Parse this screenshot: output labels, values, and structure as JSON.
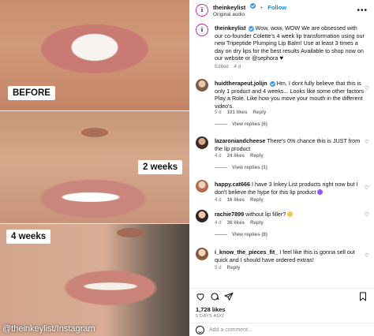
{
  "photos": {
    "labels": {
      "before": "BEFORE",
      "two_weeks": "2 weeks",
      "four_weeks": "4 weeks"
    },
    "credit": "@theinkeylist/Instagram"
  },
  "post": {
    "username": "theinkeylist",
    "follow_label": "Follow",
    "audio": "Original audio",
    "caption": {
      "user": "theinkeylist",
      "text": "Wow, wow, WOW We are obsessed with our co-founder Colette's 4 week lip transformation using our new Tripeptide Plumping Lip Balm! Use at least 3 times a day on dry lips for the best results Available to shop now on our website or @sephora",
      "edited": "Edited",
      "time": "4 d"
    },
    "comments": [
      {
        "user": "huidtherapeut.jolijn",
        "text": "Hm, I dont fully believe that this is only 1 product and 4 weeks... Looks like some other factors Play a Role. Like how you move your mouth in the different video's.",
        "time": "5 d",
        "likes": "101 likes",
        "reply": "Reply",
        "view_replies": "View replies (6)"
      },
      {
        "user": "lazaroniandcheese",
        "text": "There's 0% chance this is JUST from the lip product",
        "time": "4 d",
        "likes": "24 likes",
        "reply": "Reply",
        "view_replies": "View replies (1)"
      },
      {
        "user": "happy.cat666",
        "text": "I have 3 Inkey List products right now but I don't believe the hype for this lip product",
        "time": "4 d",
        "likes": "16 likes",
        "reply": "Reply",
        "view_replies": ""
      },
      {
        "user": "rachie7899",
        "text": "without lip filler?",
        "time": "4 d",
        "likes": "36 likes",
        "reply": "Reply",
        "view_replies": "View replies (8)"
      },
      {
        "user": "i_know_the_pieces_fit_",
        "text": "I feel like this is gonna sell out quick and I should have ordered extras!",
        "time": "5 d",
        "likes": "",
        "reply": "Reply",
        "view_replies": ""
      }
    ],
    "likes": "1,728 likes",
    "date": "5 DAYS AGO",
    "comment_placeholder": "Add a comment..."
  },
  "icons": [
    "heart-icon",
    "comment-icon",
    "share-icon",
    "bookmark-icon",
    "more-icon",
    "emoji-icon"
  ],
  "colors": {
    "follow": "#0095f6",
    "verified": "#3897f0",
    "muted": "#737373"
  }
}
